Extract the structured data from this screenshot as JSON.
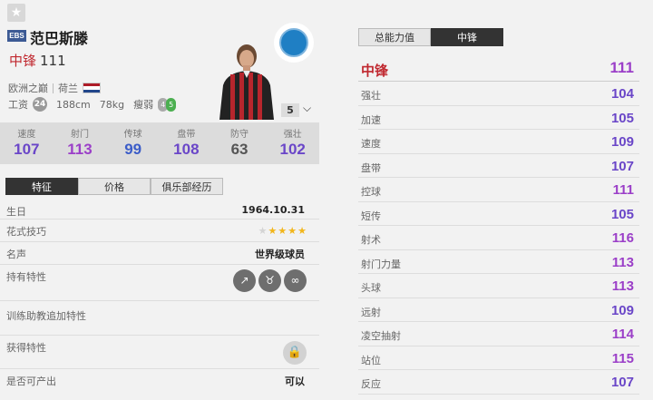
{
  "player": {
    "season_badge": "EBS",
    "name": "范巴斯滕",
    "position": "中锋",
    "ovr": "111",
    "league": "欧洲之巅",
    "nation": "荷兰",
    "wage_label": "工资",
    "wage": "24",
    "height": "188cm",
    "weight": "78kg",
    "body": "瘦弱",
    "weak_foot": "4",
    "strong_foot": "5",
    "level": "5",
    "nation_flag_colors": [
      "#ae1c28",
      "#ffffff",
      "#21468b"
    ]
  },
  "summary_stats": [
    {
      "label": "速度",
      "value": "107",
      "color": "#6a46c8"
    },
    {
      "label": "射门",
      "value": "113",
      "color": "#9b3fc8"
    },
    {
      "label": "传球",
      "value": "99",
      "color": "#3c5dc8"
    },
    {
      "label": "盘带",
      "value": "108",
      "color": "#6a46c8"
    },
    {
      "label": "防守",
      "value": "63",
      "color": "#555555"
    },
    {
      "label": "强壮",
      "value": "102",
      "color": "#6a46c8"
    }
  ],
  "left_tabs": [
    "特征",
    "价格",
    "俱乐部经历"
  ],
  "details": {
    "birthday_label": "生日",
    "birthday": "1964.10.31",
    "skill_label": "花式技巧",
    "skill_stars": 4,
    "fame_label": "名声",
    "fame": "世界级球员",
    "traits_label": "持有特性",
    "trait_icons": [
      "finesse-shot-icon",
      "bull-icon",
      "dribble-icon"
    ],
    "coach_label": "训练助教追加特性",
    "obtain_label": "获得特性",
    "produce_label": "是否可产出",
    "produce": "可以"
  },
  "right_tabs": [
    "总能力值",
    "中锋"
  ],
  "attributes_header": {
    "label": "中锋",
    "value": "111"
  },
  "attributes": [
    {
      "label": "强壮",
      "value": "104",
      "color": "#6a46c8"
    },
    {
      "label": "加速",
      "value": "105",
      "color": "#6a46c8"
    },
    {
      "label": "速度",
      "value": "109",
      "color": "#6a46c8"
    },
    {
      "label": "盘带",
      "value": "107",
      "color": "#6a46c8"
    },
    {
      "label": "控球",
      "value": "111",
      "color": "#9b3fc8"
    },
    {
      "label": "短传",
      "value": "105",
      "color": "#6a46c8"
    },
    {
      "label": "射术",
      "value": "116",
      "color": "#9b3fc8"
    },
    {
      "label": "射门力量",
      "value": "113",
      "color": "#9b3fc8"
    },
    {
      "label": "头球",
      "value": "113",
      "color": "#9b3fc8"
    },
    {
      "label": "远射",
      "value": "109",
      "color": "#6a46c8"
    },
    {
      "label": "凌空抽射",
      "value": "114",
      "color": "#9b3fc8"
    },
    {
      "label": "站位",
      "value": "115",
      "color": "#9b3fc8"
    },
    {
      "label": "反应",
      "value": "107",
      "color": "#6a46c8"
    }
  ]
}
